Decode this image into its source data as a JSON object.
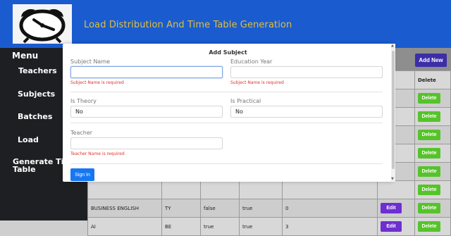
{
  "header": {
    "title": "Load Distribution And Time Table Generation"
  },
  "colors": {
    "header_bg": "#1a5cd0",
    "title": "#e1bf3a",
    "sidebar": "#1e1f22",
    "delete": "#56c32b",
    "edit": "#6d2fd0",
    "primary": "#1677f2",
    "error": "#e0302a"
  },
  "sidebar": {
    "menu_label": "Menu",
    "items": [
      {
        "label": "Teachers"
      },
      {
        "label": "Subjects"
      },
      {
        "label": "Batches"
      },
      {
        "label": "Load"
      },
      {
        "label": "Generate Time Table"
      }
    ]
  },
  "toolbar": {
    "add_new": "Add New"
  },
  "table": {
    "delete_header": "Delete",
    "rows": [
      {
        "subject": "",
        "year": "",
        "theory": "",
        "practical": "",
        "count": "",
        "edit": "",
        "delete": "Delete"
      },
      {
        "subject": "",
        "year": "",
        "theory": "",
        "practical": "",
        "count": "",
        "edit": "",
        "delete": "Delete"
      },
      {
        "subject": "",
        "year": "",
        "theory": "",
        "practical": "",
        "count": "",
        "edit": "",
        "delete": "Delete"
      },
      {
        "subject": "",
        "year": "",
        "theory": "",
        "practical": "",
        "count": "",
        "edit": "",
        "delete": "Delete"
      },
      {
        "subject": "",
        "year": "",
        "theory": "",
        "practical": "",
        "count": "",
        "edit": "",
        "delete": "Delete"
      },
      {
        "subject": "",
        "year": "",
        "theory": "",
        "practical": "",
        "count": "",
        "edit": "",
        "delete": "Delete"
      },
      {
        "subject": "BUSINESS ENGLISH",
        "year": "TY",
        "theory": "false",
        "practical": "true",
        "count": "0",
        "edit": "Edit",
        "delete": "Delete"
      },
      {
        "subject": "AI",
        "year": "BE",
        "theory": "true",
        "practical": "true",
        "count": "3",
        "edit": "Edit",
        "delete": "Delete"
      }
    ]
  },
  "modal": {
    "title": "Add Subject",
    "subject_name": {
      "label": "Subject Name",
      "value": "",
      "error": "Subject Name is required"
    },
    "education_year": {
      "label": "Education Year",
      "value": "",
      "error": "Subject Name is required"
    },
    "is_theory": {
      "label": "Is Theory",
      "value": "No"
    },
    "is_practical": {
      "label": "Is Practical",
      "value": "No"
    },
    "teacher": {
      "label": "Teacher",
      "value": "",
      "error": "Teacher Name is required"
    },
    "submit": "Sign In"
  }
}
